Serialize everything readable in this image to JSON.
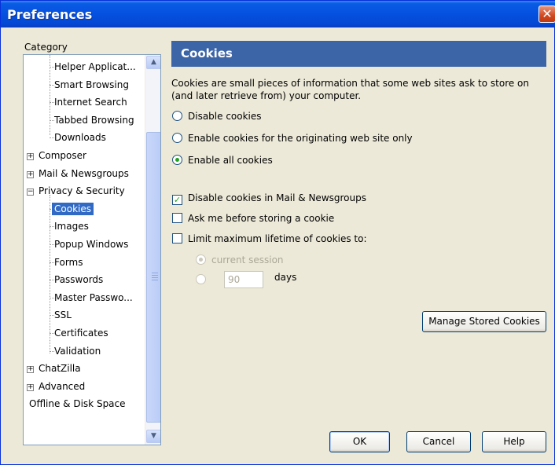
{
  "window": {
    "title": "Preferences",
    "close_glyph": "✕"
  },
  "category": {
    "label": "Category",
    "items": [
      {
        "label": "Helper Applicat...",
        "level": "child"
      },
      {
        "label": "Smart Browsing",
        "level": "child"
      },
      {
        "label": "Internet Search",
        "level": "child"
      },
      {
        "label": "Tabbed Browsing",
        "level": "child"
      },
      {
        "label": "Downloads",
        "level": "child"
      },
      {
        "label": "Composer",
        "level": "top",
        "expander": "+"
      },
      {
        "label": "Mail & Newsgroups",
        "level": "top",
        "expander": "+"
      },
      {
        "label": "Privacy & Security",
        "level": "top",
        "expander": "−"
      },
      {
        "label": "Cookies",
        "level": "child",
        "selected": true
      },
      {
        "label": "Images",
        "level": "child"
      },
      {
        "label": "Popup Windows",
        "level": "child"
      },
      {
        "label": "Forms",
        "level": "child"
      },
      {
        "label": "Passwords",
        "level": "child"
      },
      {
        "label": "Master Passwo...",
        "level": "child"
      },
      {
        "label": "SSL",
        "level": "child"
      },
      {
        "label": "Certificates",
        "level": "child"
      },
      {
        "label": "Validation",
        "level": "child"
      },
      {
        "label": "ChatZilla",
        "level": "top",
        "expander": "+"
      },
      {
        "label": "Advanced",
        "level": "top",
        "expander": "+"
      },
      {
        "label": "Offline & Disk Space",
        "level": "top"
      }
    ],
    "scroll_up_glyph": "▲",
    "scroll_down_glyph": "▼"
  },
  "panel": {
    "title": "Cookies",
    "description": "Cookies are small pieces of information that some web sites ask to store on (and later retrieve from) your computer.",
    "radios": {
      "disable": "Disable cookies",
      "originating": "Enable cookies for the originating web site only",
      "enable_all": "Enable all cookies",
      "selected": "enable_all"
    },
    "checks": {
      "mail_news": {
        "label": "Disable cookies in Mail & Newsgroups",
        "checked": true
      },
      "ask_me": {
        "label": "Ask me before storing a cookie",
        "checked": false
      },
      "limit_lifetime": {
        "label": "Limit maximum lifetime of cookies to:",
        "checked": false
      }
    },
    "lifetime": {
      "current_session": "current session",
      "days_value": "90",
      "days_label": "days"
    },
    "manage_button": "Manage Stored Cookies"
  },
  "buttons": {
    "ok": "OK",
    "cancel": "Cancel",
    "help": "Help"
  },
  "colors": {
    "accent": "#3c65a8",
    "selection": "#316ac5",
    "titlebar": "#0550e0"
  }
}
